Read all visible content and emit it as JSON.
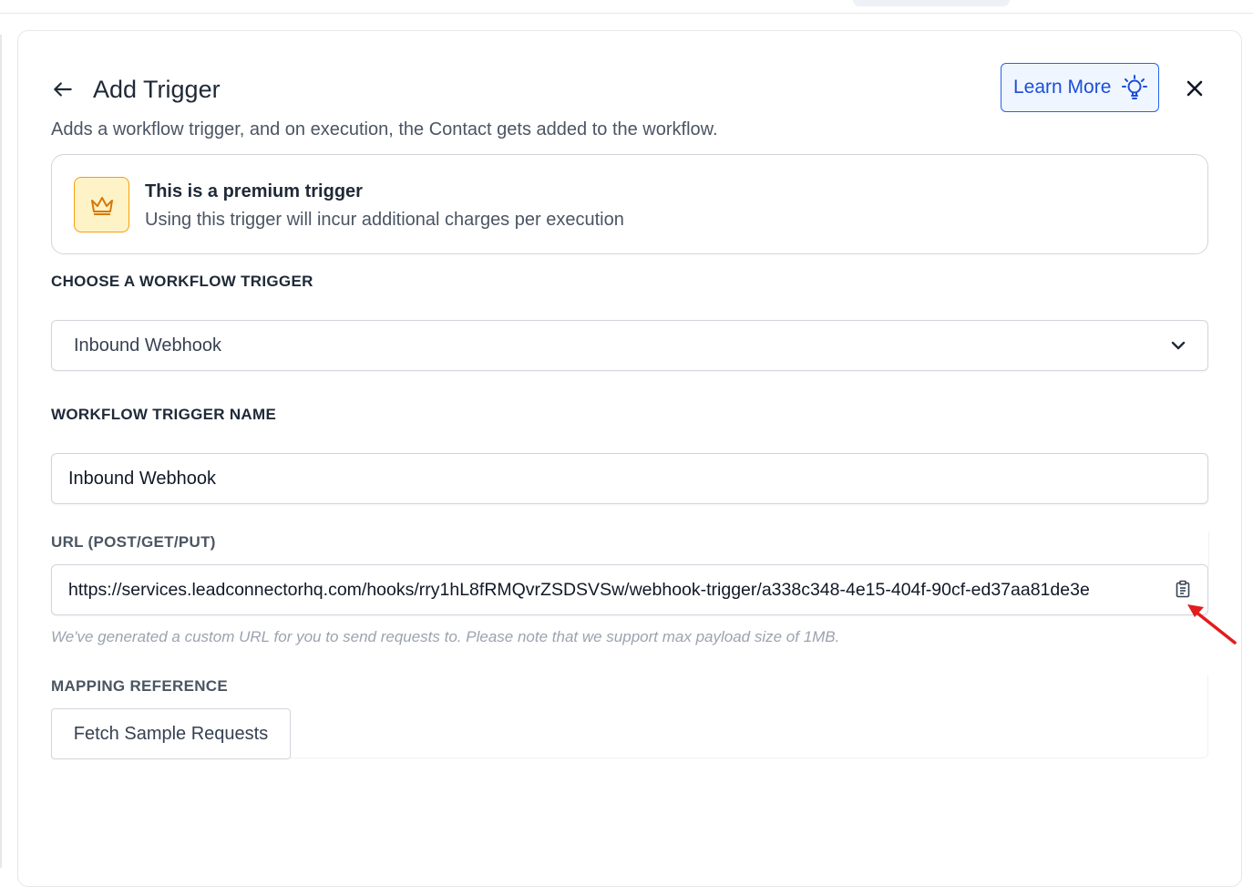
{
  "header": {
    "title": "Add Trigger",
    "learn_more_label": "Learn More",
    "subtitle": "Adds a workflow trigger, and on execution, the Contact gets added to the workflow."
  },
  "premium": {
    "title": "This is a premium trigger",
    "description": "Using this trigger will incur additional charges per execution"
  },
  "trigger_select": {
    "label": "CHOOSE A WORKFLOW TRIGGER",
    "selected": "Inbound Webhook"
  },
  "trigger_name": {
    "label": "WORKFLOW TRIGGER NAME",
    "value": "Inbound Webhook"
  },
  "url": {
    "label": "URL (POST/GET/PUT)",
    "value": "https://services.leadconnectorhq.com/hooks/rry1hL8fRMQvrZSDSVSw/webhook-trigger/a338c348-4e15-404f-90cf-ed37aa81de3e",
    "hint": "We've generated a custom URL for you to send requests to. Please note that we support max payload size of 1MB."
  },
  "mapping": {
    "label": "MAPPING REFERENCE",
    "fetch_button": "Fetch Sample Requests"
  },
  "colors": {
    "accent": "#1d4ed8",
    "premium_bg": "#fef3c7",
    "premium_border": "#f59e0b",
    "annotation_arrow": "#e11d1d"
  }
}
